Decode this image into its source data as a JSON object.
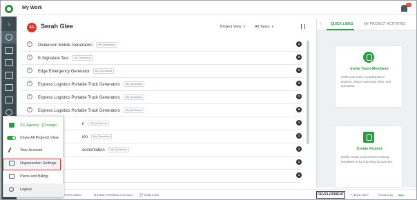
{
  "topbar": {
    "title": "My Work",
    "notification_count": "45"
  },
  "user": {
    "initials": "SG",
    "name": "Serah Glee"
  },
  "filters": {
    "view": "Project View",
    "tasks": "All Tasks"
  },
  "tag_label": "My Questions",
  "projects": [
    {
      "name": "Dickenson Mobile Generators",
      "count": "1",
      "visible_name": "Dickenson Mobile Generators"
    },
    {
      "name": "E-Signature Test",
      "count": "2",
      "visible_name": "E-Signature Test"
    },
    {
      "name": "Edge Emergency Generator",
      "count": "1",
      "visible_name": "Edge Emergency Generator"
    },
    {
      "name": "Express Logistics Portable Truck Generators",
      "count": "1",
      "visible_name": "Express Logistics Portable Truck Generators"
    },
    {
      "name": "Express Logistics Portable Truck Generators",
      "count": "1",
      "visible_name": "Express Logistics Portable Truck Generators"
    },
    {
      "name": "Express Logistics Portable Truck Generators",
      "count": "9",
      "visible_name": "Express Logistics Portable Truck Generators"
    },
    {
      "name": "n",
      "count": "1",
      "visible_name": "n"
    },
    {
      "name": "ion",
      "count": "1",
      "visible_name": "ion"
    },
    {
      "name": "cumentation",
      "count": "1",
      "visible_name": "cumentation"
    },
    {
      "name": "",
      "count": "1",
      "visible_name": ""
    },
    {
      "name": "",
      "count": "1",
      "visible_name": ""
    }
  ],
  "right_panel": {
    "tab_quick_links": "QUICK LINKS",
    "tab_activities": "MY PROJECT ACTIVITIES",
    "cards": [
      {
        "title": "Invite Team Members",
        "desc": "Invite your team to participate in projects, share comments, files, and questions."
      },
      {
        "title": "Create Project",
        "desc": "Easily create projects from existing templates or by importing documents."
      }
    ]
  },
  "bottombar": {
    "report_bug": "REPORT A BUG",
    "email_contact": "EMAIL INTERNAL CONTACT",
    "team_chat": "TEAM CHAT",
    "development": "DEVELOPMENT",
    "need_help": "NEED HELP",
    "powered_by": "Powered by",
    "brand": "rfpio"
  },
  "menu": {
    "agency": "SG Agency",
    "change": "[Change]",
    "show_all": "Show All Projects View",
    "your_account": "Your Account",
    "org_settings": "Organization Settings",
    "plans_billing": "Plans and Billing",
    "logout": "Logout"
  },
  "colors": {
    "accent": "#2f9a45",
    "rail": "#3c4a52",
    "avatar": "#d9332e",
    "highlight": "#d62828"
  }
}
